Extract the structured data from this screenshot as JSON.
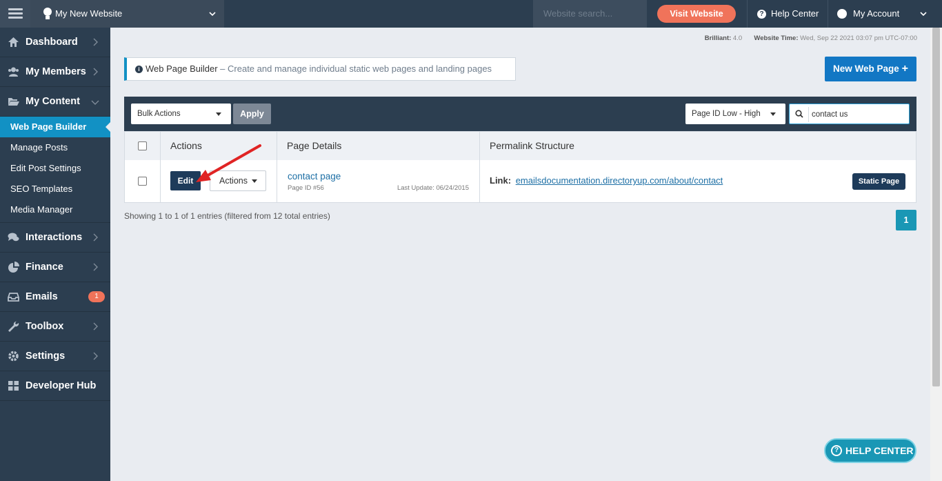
{
  "topbar": {
    "site_name": "My New Website",
    "search_placeholder": "Website search...",
    "visit_label": "Visit Website",
    "help_label": "Help Center",
    "account_label": "My Account",
    "icons": [
      "menu-icon",
      "lightbulb-icon",
      "chevron-down-icon",
      "question-icon",
      "user-icon"
    ]
  },
  "sidebar": {
    "items": [
      {
        "label": "Dashboard",
        "icon": "home-icon"
      },
      {
        "label": "My Members",
        "icon": "users-icon"
      },
      {
        "label": "My Content",
        "icon": "folder-open-icon"
      },
      {
        "label": "Interactions",
        "icon": "comments-icon"
      },
      {
        "label": "Finance",
        "icon": "pie-chart-icon"
      },
      {
        "label": "Emails",
        "icon": "inbox-icon",
        "badge": "1"
      },
      {
        "label": "Toolbox",
        "icon": "wrench-icon"
      },
      {
        "label": "Settings",
        "icon": "gear-icon"
      },
      {
        "label": "Developer Hub",
        "icon": "grid-icon"
      }
    ],
    "submenu": [
      {
        "label": "Web Page Builder",
        "active": true
      },
      {
        "label": "Manage Posts"
      },
      {
        "label": "Edit Post Settings"
      },
      {
        "label": "SEO Templates"
      },
      {
        "label": "Media Manager"
      }
    ]
  },
  "meta": {
    "version_label": "Brilliant:",
    "version_value": "4.0",
    "time_label": "Website Time:",
    "time_value": "Wed, Sep 22 2021 03:07 pm UTC-07:00"
  },
  "header": {
    "title": "Web Page Builder",
    "description": "– Create and manage individual static web pages and landing pages",
    "new_button": "New Web Page",
    "new_button_icon": "+"
  },
  "toolbar": {
    "bulk_actions": "Bulk Actions",
    "apply": "Apply",
    "sort": "Page ID Low - High",
    "search_value": "contact us"
  },
  "table": {
    "columns": [
      "Actions",
      "Page Details",
      "Permalink Structure"
    ],
    "rows": [
      {
        "edit": "Edit",
        "actions": "Actions",
        "page_name": "contact page",
        "page_id": "Page ID #56",
        "last_update": "Last Update: 06/24/2015",
        "link_label": "Link:",
        "link_url": "emailsdocumentation.directoryup.com/about/contact",
        "type": "Static Page"
      }
    ]
  },
  "footer": {
    "showing": "Showing 1 to 1 of 1 entries (filtered from 12 total entries)",
    "page": "1"
  },
  "help_float": {
    "label": "HELP CENTER",
    "icon": "?"
  },
  "colors": {
    "topbar": "#2c3e50",
    "accent": "#1291c4",
    "visit": "#f0735a",
    "annotation_arrow": "#e02424"
  }
}
